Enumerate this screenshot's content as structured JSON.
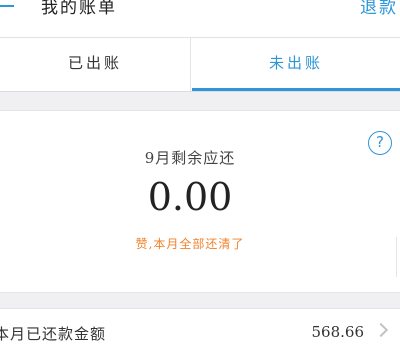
{
  "header": {
    "title": "我的账单",
    "refund_label": "退款"
  },
  "tabs": [
    {
      "label": "已出账",
      "active": false
    },
    {
      "label": "未出账",
      "active": true
    }
  ],
  "summary": {
    "period_label": "9月剩余应还",
    "amount": "0.00",
    "status_message": "赞,本月全部还清了",
    "help_icon": "?"
  },
  "repaid": {
    "label": "本月已还款金额",
    "value": "568.66"
  },
  "colors": {
    "accent": "#2d96d6",
    "status": "#f0822c",
    "background": "#f0f0f2"
  }
}
